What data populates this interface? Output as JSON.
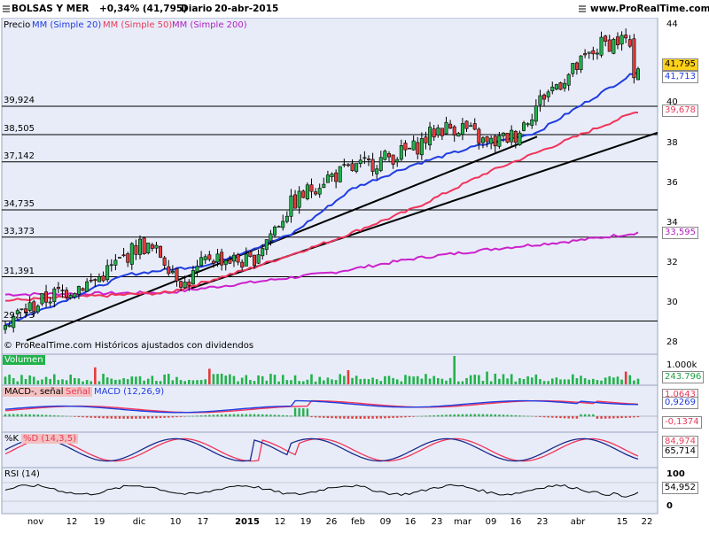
{
  "header": {
    "instrument": "BOLSAS Y MER",
    "change": "+0,34% (41,795)",
    "period": "Diario",
    "date": "20-abr-2015",
    "site": "www.ProRealTime.com"
  },
  "legend": {
    "price": "Precio",
    "ma20": "MM (Simple 20)",
    "ma50": "MM (Simple 50)",
    "ma200": "MM (Simple 200)",
    "copyright": "© ProRealTime.com Históricos ajustados con dividendos"
  },
  "colors": {
    "up": "#22b24c",
    "down": "#e63a3a",
    "ma20": "#1f3ce0",
    "ma50": "#f0345a",
    "ma200": "#cc22cc",
    "panel_bg": "#e8ecf8",
    "macd_line": "#1f3ce0",
    "signal_line": "#f0345a",
    "volume": "#22b24c"
  },
  "price_axis": {
    "ticks": [
      "44",
      "42",
      "40",
      "38",
      "36",
      "34",
      "32",
      "30",
      "28"
    ]
  },
  "badges": {
    "last": "41,795",
    "ma20": "41,713",
    "ma50": "39,678",
    "ma200": "33,595",
    "volume_scale": "1.000k",
    "volume_value": "243.796",
    "macd1": "1,0643",
    "macd2": "0,9269",
    "macd_hist": "-0,1374",
    "stoch1": "84,974",
    "stoch2": "65,714",
    "rsi_top": "100",
    "rsi_val": "54,952",
    "rsi_bottom": "0"
  },
  "hlines": [
    "39,924",
    "38,505",
    "37,142",
    "34,735",
    "33,373",
    "31,391",
    "29,173"
  ],
  "panels": {
    "volume": "Volumen",
    "macd_a": "MACD-, señal",
    "macd_b": "Señal",
    "macd_c": "MACD (12,26,9)",
    "stoch_a": "%K",
    "stoch_b": "%D (14,3,5)",
    "rsi": "RSI (14)"
  },
  "x_axis": [
    "nov",
    "12",
    "19",
    "dic",
    "10",
    "17",
    "2015",
    "12",
    "19",
    "26",
    "feb",
    "09",
    "16",
    "23",
    "mar",
    "09",
    "16",
    "23",
    "abr",
    "15",
    "22"
  ],
  "chart_data": {
    "type": "candlestick",
    "title": "BOLSAS Y MER",
    "ylim": [
      28,
      44
    ],
    "x_labels": [
      "nov",
      "12",
      "19",
      "dic",
      "10",
      "17",
      "2015",
      "12",
      "19",
      "26",
      "feb",
      "09",
      "16",
      "23",
      "mar",
      "09",
      "16",
      "23",
      "abr",
      "15",
      "22"
    ],
    "horizontal_lines": [
      39.924,
      38.505,
      37.142,
      34.735,
      33.373,
      31.391,
      29.173
    ],
    "series": [
      {
        "name": "Precio",
        "start": 29.0,
        "end": 41.795,
        "high": 43.5,
        "low": 28.6
      },
      {
        "name": "MM (Simple 20)",
        "last": 41.713
      },
      {
        "name": "MM (Simple 50)",
        "last": 39.678
      },
      {
        "name": "MM (Simple 200)",
        "last": 33.595
      }
    ],
    "key_closes": [
      [
        0,
        29.2
      ],
      [
        12,
        30.5
      ],
      [
        22,
        31.2
      ],
      [
        33,
        33.0
      ],
      [
        38,
        32.5
      ],
      [
        44,
        31.0
      ],
      [
        50,
        32.4
      ],
      [
        60,
        32.1
      ],
      [
        70,
        35.0
      ],
      [
        78,
        36.3
      ],
      [
        90,
        37.1
      ],
      [
        100,
        37.8
      ],
      [
        106,
        38.8
      ],
      [
        112,
        38.9
      ],
      [
        118,
        38.0
      ],
      [
        125,
        38.5
      ],
      [
        132,
        40.5
      ],
      [
        138,
        41.5
      ],
      [
        146,
        43.0
      ],
      [
        152,
        43.3
      ],
      [
        154,
        41.7
      ],
      [
        155,
        41.795
      ]
    ],
    "ma20_keys": [
      [
        0,
        29.0
      ],
      [
        30,
        31.5
      ],
      [
        50,
        32.0
      ],
      [
        70,
        33.5
      ],
      [
        85,
        35.8
      ],
      [
        100,
        37.0
      ],
      [
        115,
        37.9
      ],
      [
        130,
        38.6
      ],
      [
        155,
        41.713
      ]
    ],
    "ma50_keys": [
      [
        0,
        30.2
      ],
      [
        40,
        30.6
      ],
      [
        60,
        31.8
      ],
      [
        80,
        33.2
      ],
      [
        100,
        34.8
      ],
      [
        118,
        36.6
      ],
      [
        135,
        38.0
      ],
      [
        155,
        39.678
      ]
    ],
    "ma200_keys": [
      [
        0,
        30.5
      ],
      [
        40,
        30.6
      ],
      [
        60,
        31.1
      ],
      [
        80,
        31.6
      ],
      [
        100,
        32.3
      ],
      [
        120,
        32.8
      ],
      [
        140,
        33.2
      ],
      [
        155,
        33.595
      ]
    ]
  }
}
